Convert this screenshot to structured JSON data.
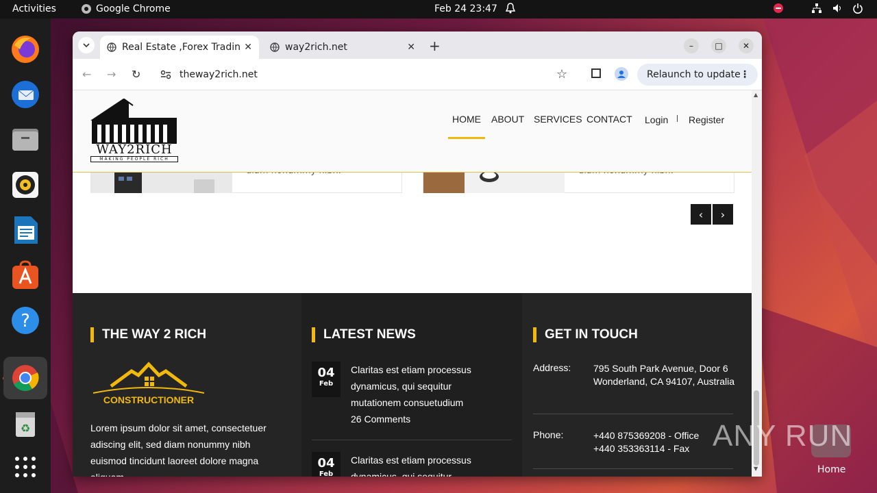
{
  "topbar": {
    "activities": "Activities",
    "app_name": "Google Chrome",
    "clock": "Feb 24  23:47"
  },
  "dock": {
    "items": [
      "firefox-icon",
      "thunderbird-icon",
      "files-icon",
      "rhythmbox-icon",
      "writer-icon",
      "app-center-icon",
      "help-icon",
      "chrome-icon",
      "trash-icon",
      "app-grid-icon"
    ]
  },
  "browser": {
    "tabs": [
      {
        "title": "Real Estate ,Forex Trading",
        "active": true
      },
      {
        "title": "way2rich.net",
        "active": false
      }
    ],
    "url": "theway2rich.net",
    "relaunch_label": "Relaunch to update"
  },
  "site": {
    "logo_brand": "WAY2RICH",
    "logo_tagline": "MAKING PEOPLE RICH",
    "nav": {
      "home": "HOME",
      "about": "ABOUT",
      "services": "SERVICES",
      "contact": "CONTACT",
      "login": "Login",
      "register": "Register"
    },
    "cards": [
      {
        "text": "diam nonummy nibh."
      },
      {
        "text": "diam nonummy nibh."
      }
    ],
    "footer": {
      "col1": {
        "heading": "THE WAY 2 RICH",
        "logo_text": "CONSTRUCTIONER",
        "body": "Lorem ipsum dolor sit amet, consectetuer adiscing elit, sed diam nonummy nibh euismod tincidunt laoreet dolore magna aliquam"
      },
      "col2": {
        "heading": "LATEST NEWS",
        "items": [
          {
            "day": "04",
            "month": "Feb",
            "text": "Claritas est etiam processus dynamicus, qui sequitur mutationem consuetudium",
            "comments": "26 Comments"
          },
          {
            "day": "04",
            "month": "Feb",
            "text": "Claritas est etiam processus dynamicus, qui sequitur",
            "comments": ""
          }
        ]
      },
      "col3": {
        "heading": "GET IN TOUCH",
        "address_label": "Address:",
        "address": "795 South Park Avenue, Door 6 Wonderland, CA 94107, Australia",
        "phone_label": "Phone:",
        "phone1": "+440 875369208 - Office",
        "phone2": "+440 353363114 - Fax"
      }
    }
  },
  "watermark": {
    "text": "ANY RUN",
    "home_label": "Home"
  },
  "colors": {
    "accent": "#f0b90b",
    "footer_bg": "#252525",
    "topbar_bg": "#141414",
    "dock_bg": "#1d1d1d"
  }
}
